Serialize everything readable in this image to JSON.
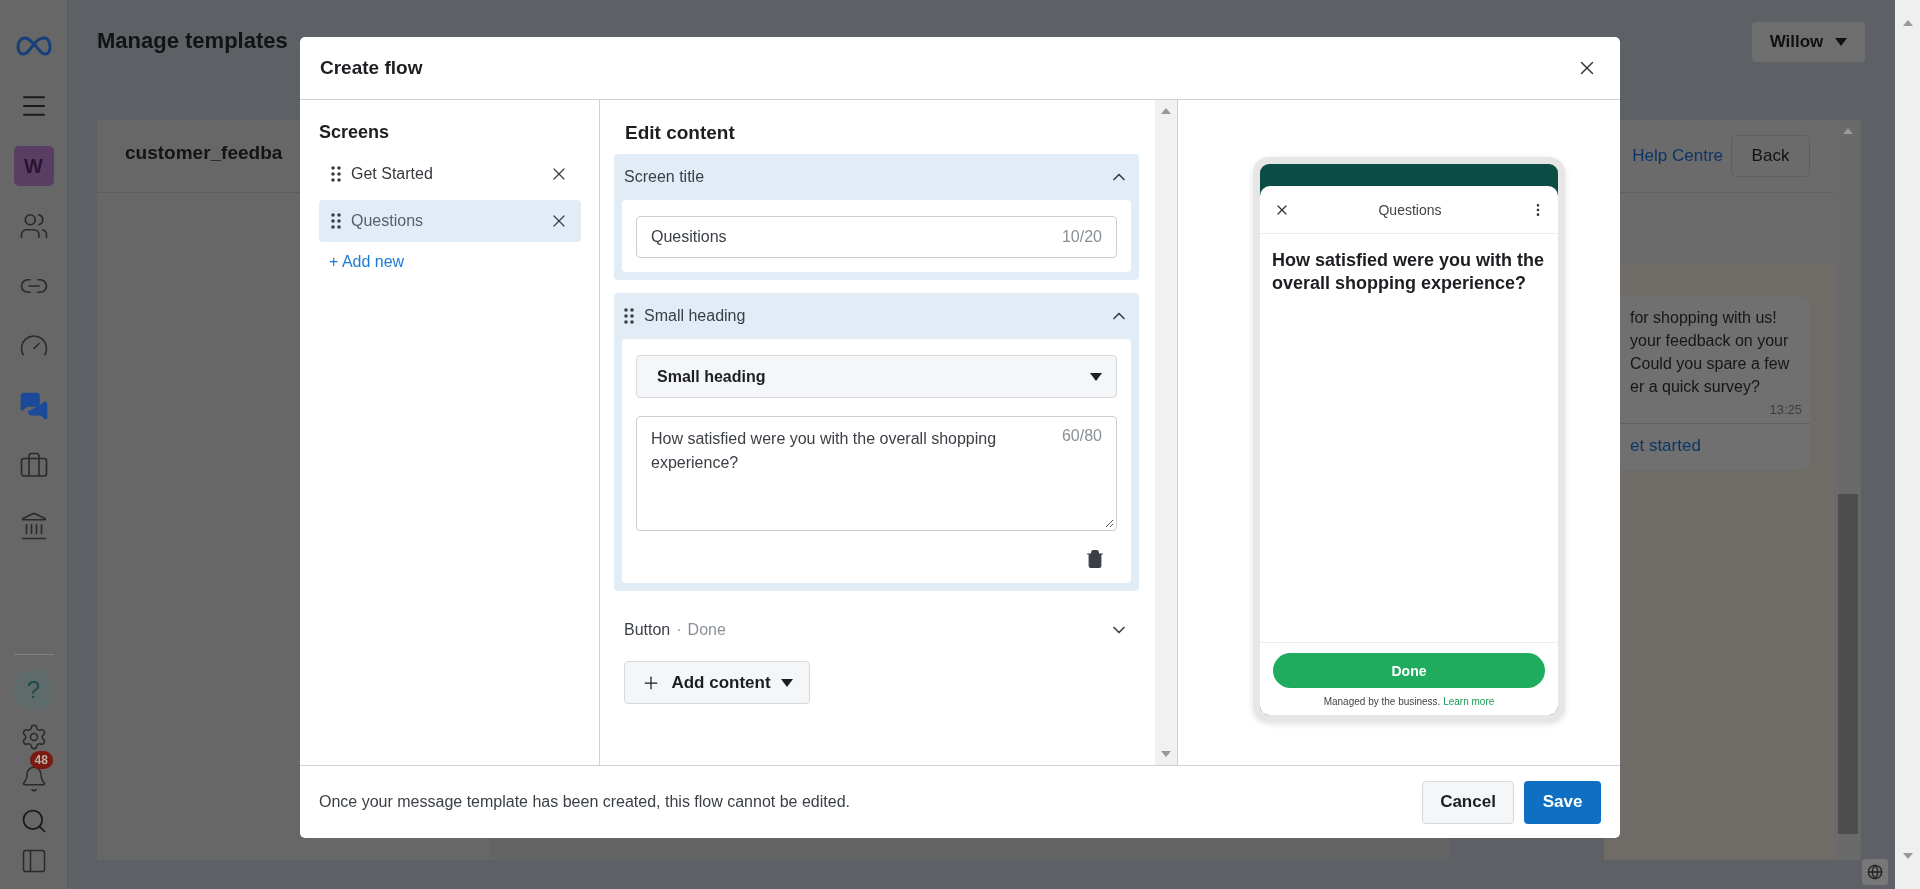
{
  "nav": {
    "avatar": "W",
    "notification_count": "48",
    "top": [
      {
        "kind": "people",
        "selected": false
      },
      {
        "kind": "link",
        "selected": false
      },
      {
        "kind": "gauge",
        "selected": false
      },
      {
        "kind": "chat",
        "selected": true
      },
      {
        "kind": "briefcase",
        "selected": false
      },
      {
        "kind": "bank",
        "selected": false
      }
    ],
    "bottom": [
      {
        "kind": "help",
        "label": "?"
      },
      {
        "kind": "settings"
      },
      {
        "kind": "bell"
      },
      {
        "kind": "search"
      },
      {
        "kind": "panel"
      }
    ]
  },
  "page": {
    "title": "Manage templates",
    "account": "Willow",
    "template_name": "customer_feedba",
    "help_link": "Help Centre",
    "back": "Back",
    "chat": {
      "lines": [
        "for shopping with us!",
        "your feedback on your",
        "Could you spare a few",
        "er a quick survey?"
      ],
      "time": "13:25",
      "action": "et started"
    }
  },
  "modal": {
    "title": "Create flow",
    "screens": {
      "heading": "Screens",
      "items": [
        {
          "label": "Get Started",
          "selected": false
        },
        {
          "label": "Questions",
          "selected": true
        }
      ],
      "add": "+ Add new"
    },
    "editor": {
      "heading": "Edit content",
      "sections": [
        {
          "kind": "title",
          "label": "Screen title",
          "expanded": true,
          "value": "Quesitions",
          "counter": "10/20"
        },
        {
          "kind": "text",
          "label": "Small heading",
          "expanded": true,
          "type": "Small heading",
          "value": "How satisfied were you with the overall shopping experience?",
          "counter": "60/80"
        },
        {
          "kind": "button",
          "label": "Button",
          "separator": "·",
          "status": "Done",
          "expanded": false
        }
      ],
      "add_content": "Add content"
    },
    "preview": {
      "title": "Questions",
      "heading": "How satisfied were you with the overall shopping experience?",
      "button": "Done",
      "footer": "Managed by the business.",
      "footer_link": "Learn more"
    },
    "footer": {
      "note": "Once your message template has been created, this flow cannot be edited.",
      "cancel": "Cancel",
      "save": "Save"
    }
  }
}
